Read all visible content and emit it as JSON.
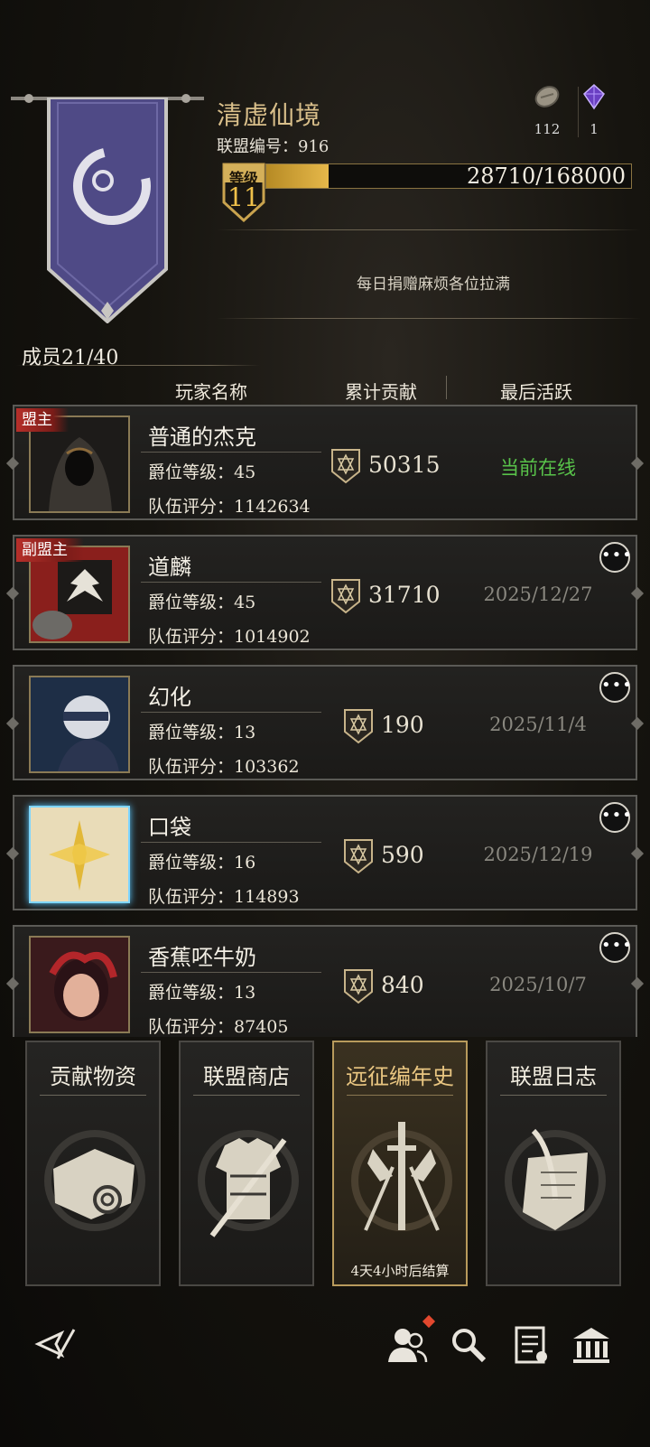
{
  "guild": {
    "name": "清虚仙境",
    "id_label": "联盟编号：916",
    "level_label": "等级",
    "level": "11",
    "xp_text": "28710/168000",
    "xp_progress": 0.171,
    "notice": "每日捐赠麻烦各位拉满"
  },
  "resources": [
    {
      "icon": "stone-coin-icon",
      "value": "112"
    },
    {
      "icon": "purple-crystal-icon",
      "value": "1"
    }
  ],
  "members": {
    "count_label": "成员21/40",
    "headers": {
      "name": "玩家名称",
      "contribution": "累计贡献",
      "last_active": "最后活跃"
    },
    "rows": [
      {
        "role": "盟主",
        "name": "普通的杰克",
        "rank": "爵位等级：45",
        "score": "队伍评分：1142634",
        "contribution": "50315",
        "last_active": "当前在线",
        "online": true,
        "more": false
      },
      {
        "role": "副盟主",
        "name": "道麟",
        "rank": "爵位等级：45",
        "score": "队伍评分：1014902",
        "contribution": "31710",
        "last_active": "2025/12/27",
        "online": false,
        "more": true
      },
      {
        "role": "",
        "name": "幻化",
        "rank": "爵位等级：13",
        "score": "队伍评分：103362",
        "contribution": "190",
        "last_active": "2025/11/4",
        "online": false,
        "more": true
      },
      {
        "role": "",
        "name": "口袋",
        "rank": "爵位等级：16",
        "score": "队伍评分：114893",
        "contribution": "590",
        "last_active": "2025/12/19",
        "online": false,
        "more": true
      },
      {
        "role": "",
        "name": "香蕉呸牛奶",
        "rank": "爵位等级：13",
        "score": "队伍评分：87405",
        "contribution": "840",
        "last_active": "2025/10/7",
        "online": false,
        "more": true
      }
    ]
  },
  "tiles": [
    {
      "label": "贡献物资",
      "icon": "scroll-bundle-icon",
      "sub": ""
    },
    {
      "label": "联盟商店",
      "icon": "armor-sword-icon",
      "sub": ""
    },
    {
      "label": "远征编年史",
      "icon": "crossed-swords-banners-icon",
      "sub": "4天4小时后结算",
      "selected": true
    },
    {
      "label": "联盟日志",
      "icon": "quill-paper-icon",
      "sub": ""
    }
  ],
  "nav": [
    "back-icon",
    "members-icon",
    "search-icon",
    "document-icon",
    "bank-icon"
  ],
  "colors": {
    "accent_gold": "#d9bf8a",
    "online_green": "#58c24a",
    "role_red": "#b62f2a"
  }
}
